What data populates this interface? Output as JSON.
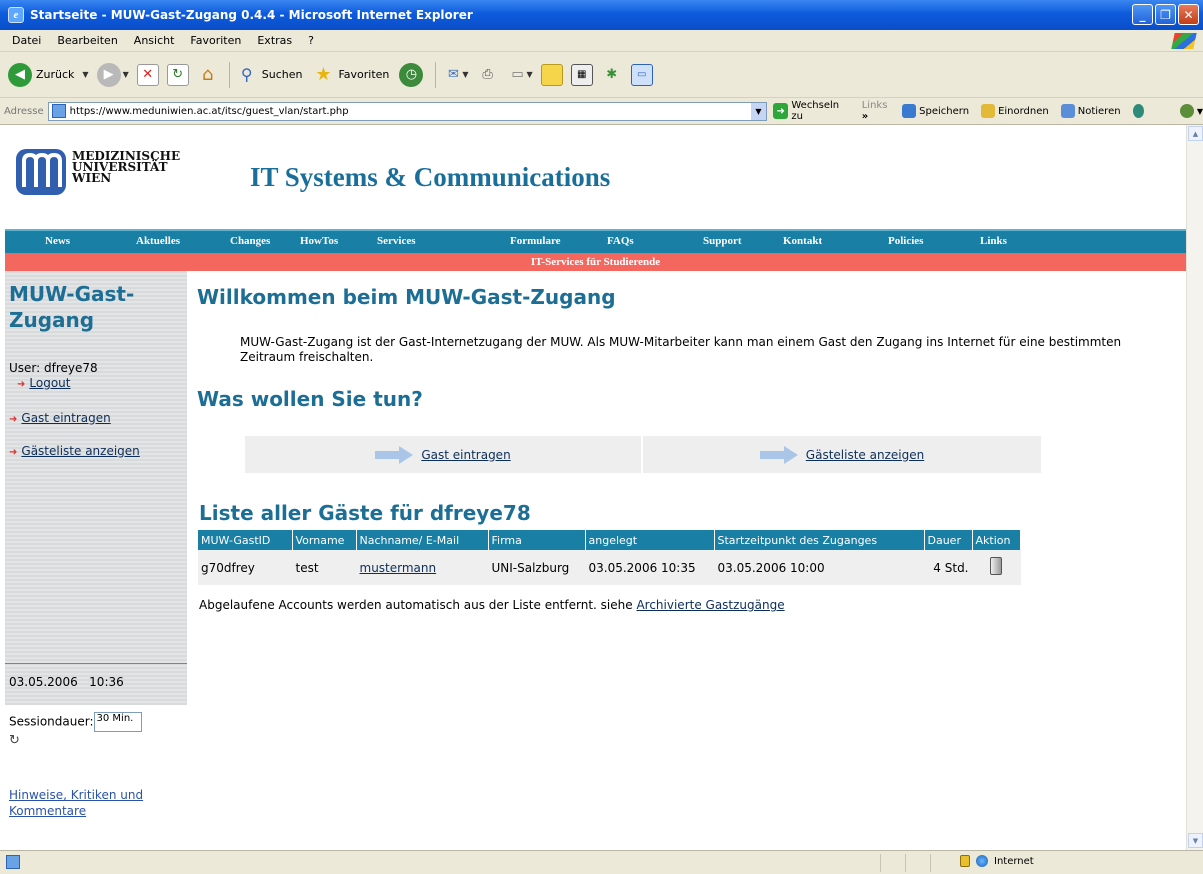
{
  "window": {
    "title": "Startseite - MUW-Gast-Zugang 0.4.4 - Microsoft Internet Explorer"
  },
  "menu": [
    "Datei",
    "Bearbeiten",
    "Ansicht",
    "Favoriten",
    "Extras",
    "?"
  ],
  "toolbar": {
    "back_label": "Zurück",
    "search_label": "Suchen",
    "favorites_label": "Favoriten"
  },
  "addressbar": {
    "label": "Adresse",
    "url": "https://www.meduniwien.ac.at/itsc/guest_vlan/start.php",
    "go_label": "Wechseln zu",
    "links_label": "Links",
    "chevron": "»",
    "save_label": "Speichern",
    "organize_label": "Einordnen",
    "notes_label": "Notieren"
  },
  "header": {
    "logo_lines": [
      "MEDIZINISCHE",
      "UNIVERSITÄT",
      "WIEN"
    ],
    "site_title": "IT Systems & Communications"
  },
  "nav": [
    "News",
    "Aktuelles",
    "Changes",
    "HowTos",
    "Services",
    "Formulare",
    "FAQs",
    "Support",
    "Kontakt",
    "Policies",
    "Links"
  ],
  "subnav": "IT-Services für Studierende",
  "sidebar": {
    "title_line1": "MUW-Gast-",
    "title_line2": "Zugang",
    "user": "User: dfreye78",
    "logout": "Logout",
    "add_guest": "Gast eintragen",
    "show_list": "Gästeliste anzeigen",
    "date": "03.05.2006",
    "time": "10:36",
    "session_label": "Sessiondauer:",
    "session_value": "30 Min.",
    "feedback_line1": "Hinweise, Kritiken und",
    "feedback_line2": "Kommentare"
  },
  "main": {
    "welcome_title": "Willkommen beim MUW-Gast-Zugang",
    "intro": "MUW-Gast-Zugang ist der Gast-Internetzugang der MUW. Als MUW-Mitarbeiter kann man einem Gast den Zugang ins Internet für eine bestimmten Zeitraum freischalten.",
    "question": "Was wollen Sie tun?",
    "action_add": "Gast eintragen",
    "action_list": "Gästeliste anzeigen",
    "list_title": "Liste aller Gäste für dfreye78",
    "table": {
      "headers": [
        "MUW-GastID",
        "Vorname",
        "Nachname/ E-Mail",
        "Firma",
        "angelegt",
        "Startzeitpunkt des Zuganges",
        "Dauer",
        "Aktion"
      ],
      "rows": [
        [
          "g70dfrey",
          "test",
          "mustermann",
          "UNI-Salzburg",
          "03.05.2006 10:35",
          "03.05.2006 10:00",
          "4 Std."
        ]
      ]
    },
    "footer_note": "Abgelaufene Accounts werden automatisch aus der Liste entfernt. siehe",
    "archive_link": "Archivierte Gastzugänge"
  },
  "statusbar": {
    "zone": "Internet"
  },
  "colors": {
    "accent": "#1a7fa4",
    "heading": "#1c6e95",
    "subnav": "#f3675f",
    "sidebar": "#dedfe1"
  }
}
